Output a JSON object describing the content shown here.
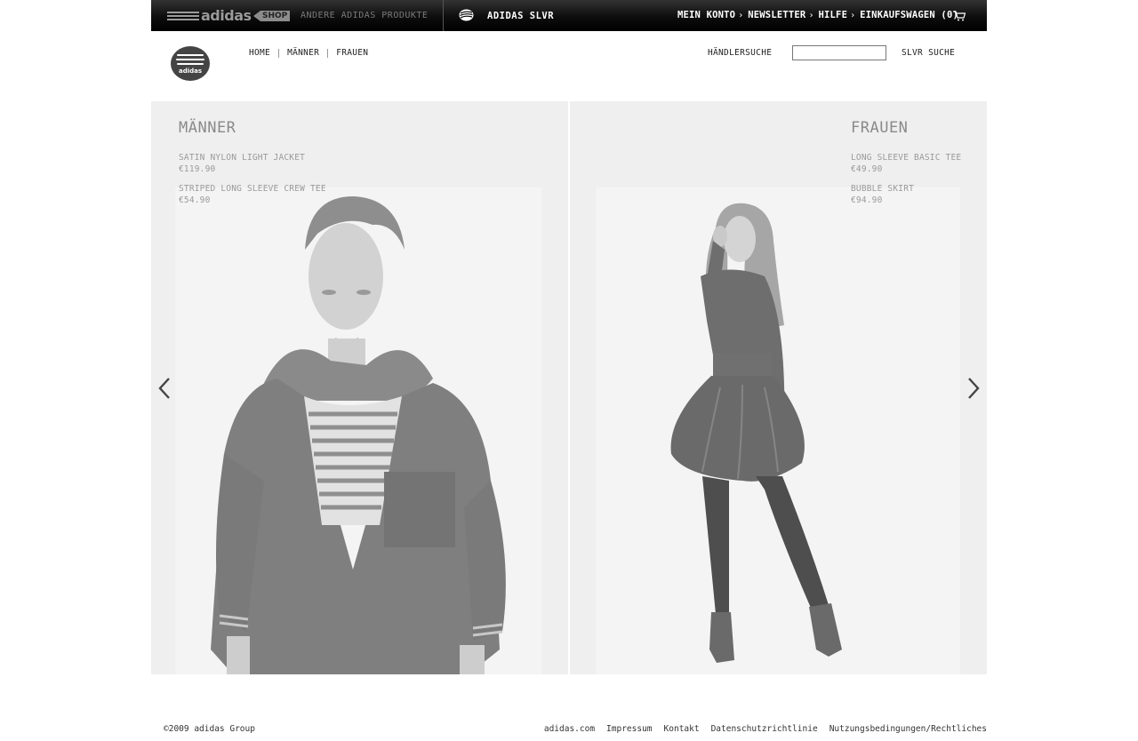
{
  "topbar": {
    "shop_logo_word": "adidas",
    "shop_logo_tag": "SHOP",
    "other_products": "ANDERE ADIDAS PRODUKTE",
    "slvr_label": "ADIDAS SLVR",
    "nav": [
      {
        "label": "MEIN KONTO"
      },
      {
        "label": "NEWSLETTER"
      },
      {
        "label": "HILFE"
      },
      {
        "label": "EINKAUFSWAGEN (0)"
      }
    ],
    "icons": [
      "adidas-shop-logo-icon",
      "slvr-logo-icon",
      "chevron-right-icon",
      "cart-icon"
    ]
  },
  "header": {
    "logo_word": "adidas",
    "nav": [
      {
        "label": "HOME"
      },
      {
        "label": "MÄNNER"
      },
      {
        "label": "FRAUEN"
      }
    ],
    "dealer_search": "HÄNDLERSUCHE",
    "search_value": "",
    "search_button": "SLVR SUCHE"
  },
  "panels": {
    "men": {
      "title": "MÄNNER",
      "products": [
        {
          "name": "SATIN NYLON LIGHT JACKET",
          "price": "€119.90"
        },
        {
          "name": "STRIPED LONG SLEEVE CREW TEE",
          "price": "€54.90"
        }
      ]
    },
    "women": {
      "title": "FRAUEN",
      "products": [
        {
          "name": "LONG SLEEVE BASIC TEE",
          "price": "€49.90"
        },
        {
          "name": "BUBBLE SKIRT",
          "price": "€94.90"
        }
      ]
    }
  },
  "carousel_icons": [
    "chevron-left-icon",
    "chevron-right-icon"
  ],
  "footer": {
    "copyright": "©2009 adidas Group",
    "links": [
      {
        "label": "adidas.com"
      },
      {
        "label": "Impressum"
      },
      {
        "label": "Kontakt"
      },
      {
        "label": "Datenschutzrichtlinie"
      },
      {
        "label": "Nutzungsbedingungen/Rechtliches"
      }
    ]
  },
  "colors": {
    "topbar": "#000000",
    "panel_bg": "#efefef",
    "muted_text": "#9a9a9a",
    "page_bg": "#ffffff"
  }
}
